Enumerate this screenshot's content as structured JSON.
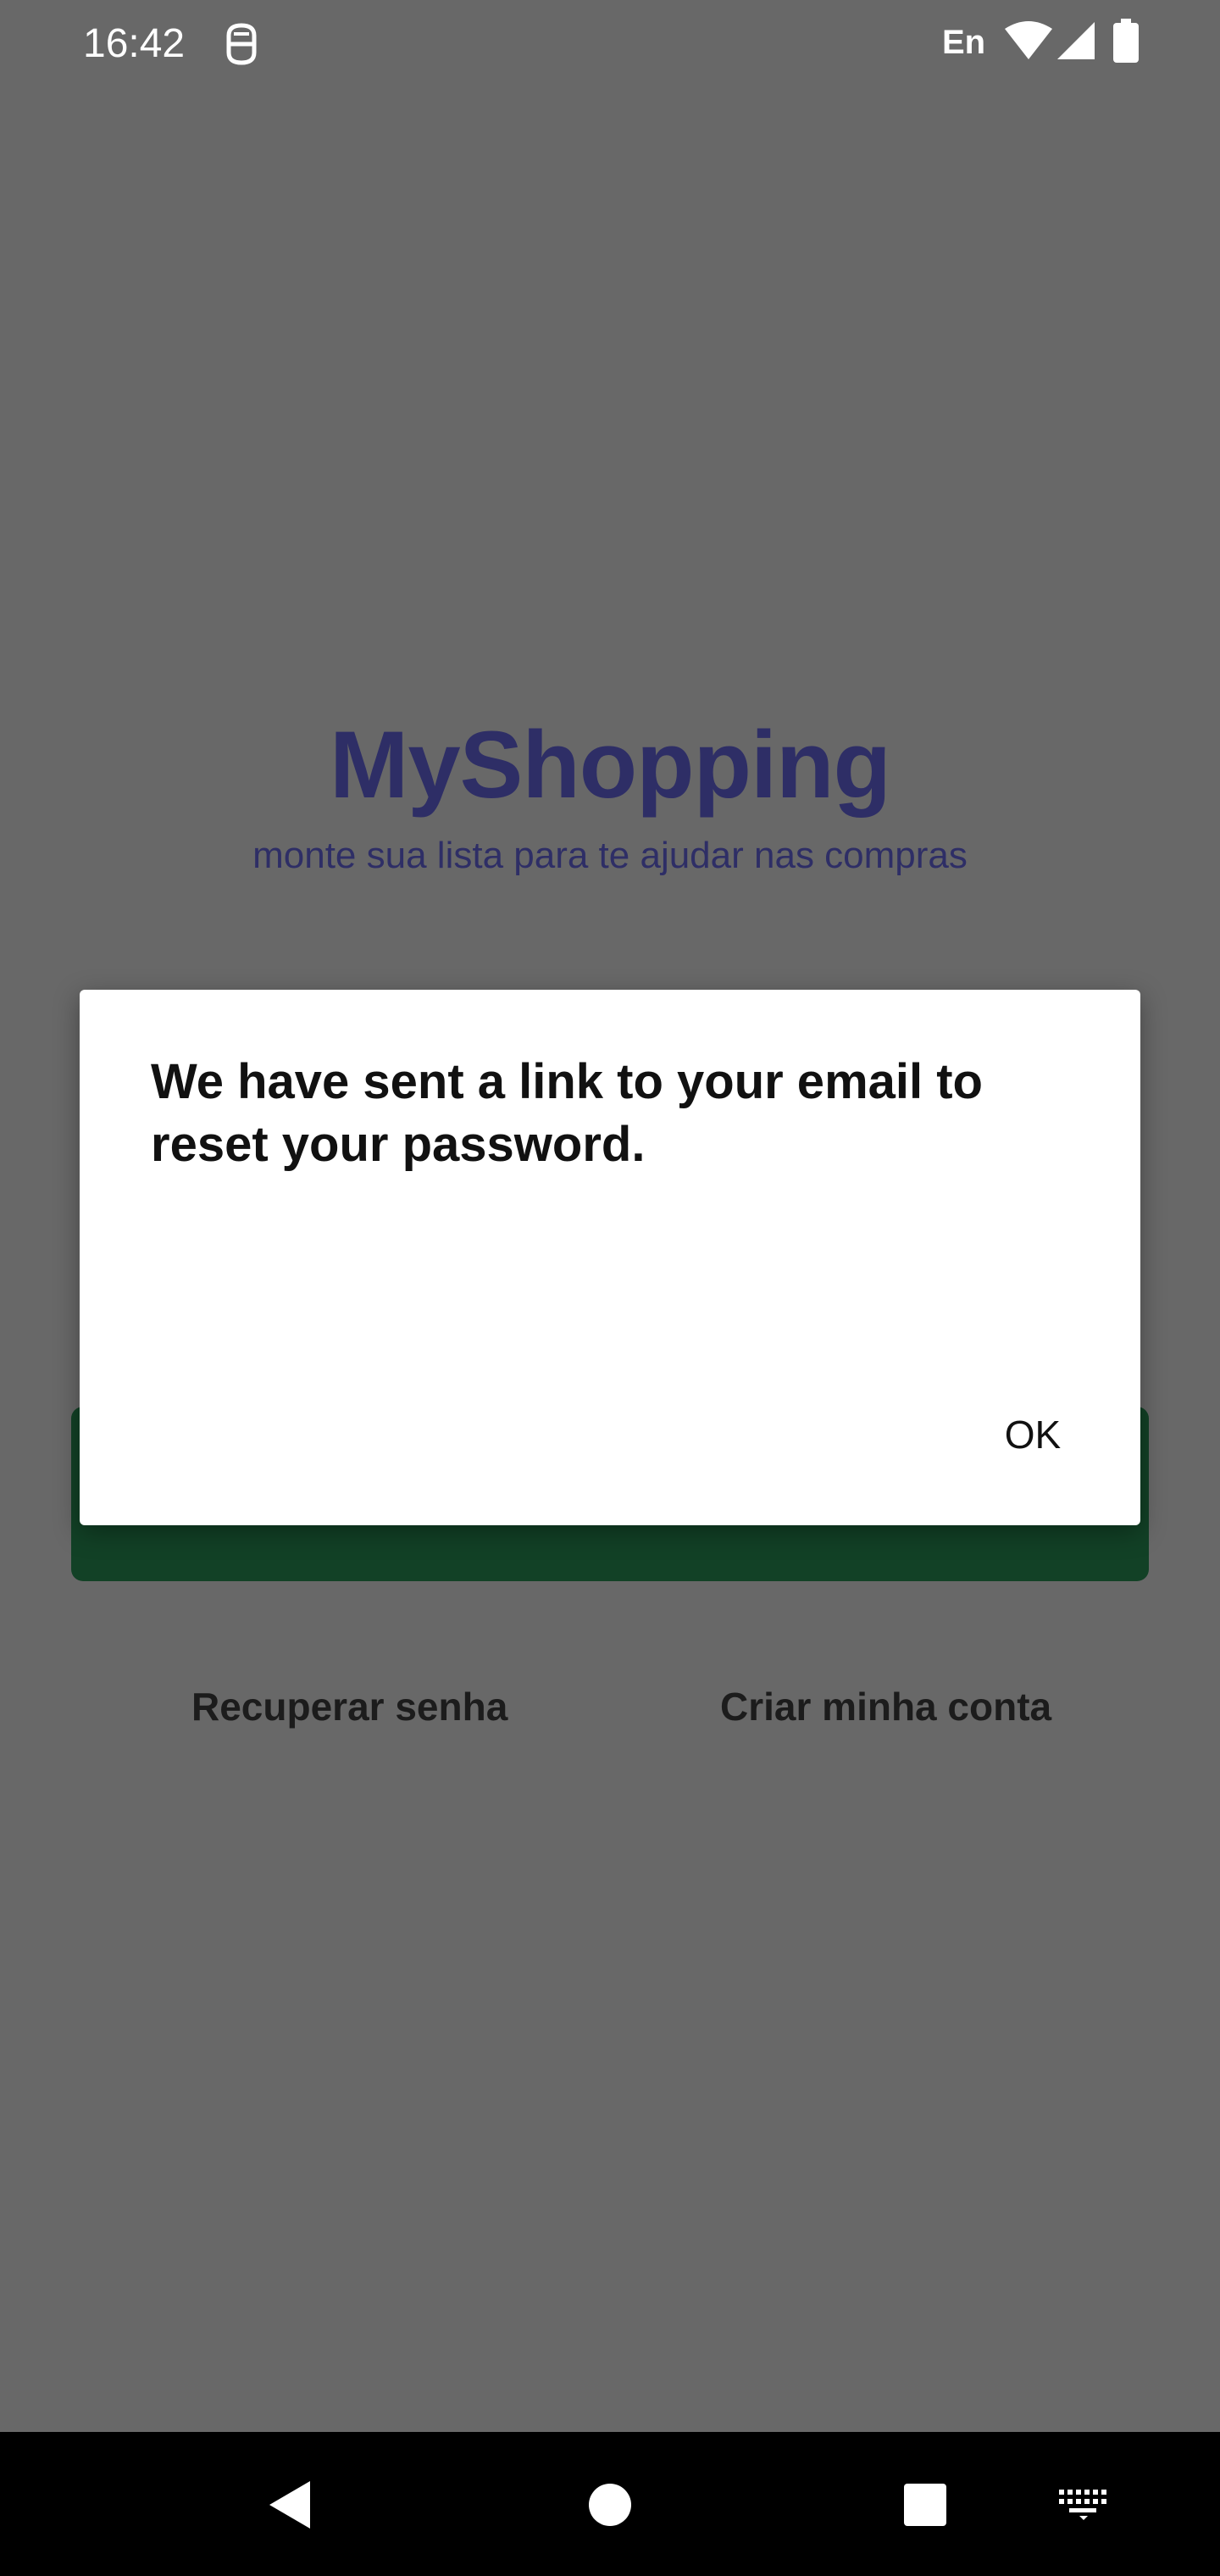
{
  "status_bar": {
    "time": "16:42",
    "app_icon": "notification-app-icon",
    "language": "En",
    "icons": [
      "wifi-icon",
      "signal-icon",
      "battery-icon"
    ]
  },
  "screen": {
    "title": "MyShopping",
    "subtitle": "monte sua lista para te ajudar nas compras",
    "title_color": "#2e2e66",
    "button_color": "#124126",
    "links": {
      "recover_password": "Recuperar senha",
      "create_account": "Criar minha conta"
    }
  },
  "dialog": {
    "message": "We have sent a link to your email to reset your password.",
    "ok_label": "OK"
  },
  "nav_bar": {
    "icons": [
      "back-icon",
      "home-icon",
      "recents-icon",
      "keyboard-icon"
    ]
  }
}
